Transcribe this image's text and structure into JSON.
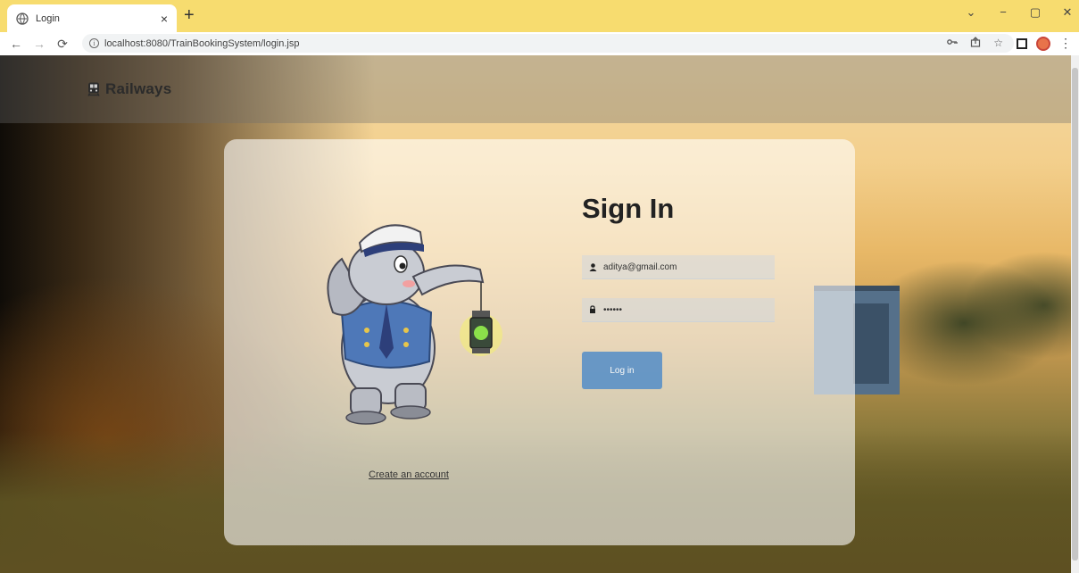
{
  "browser": {
    "tab_title": "Login",
    "tab_close": "×",
    "new_tab": "+",
    "url": "localhost:8080/TrainBookingSystem/login.jsp",
    "window_controls": [
      "⌄",
      "−",
      "▢",
      "✕"
    ],
    "icons": [
      "globe-icon",
      "key-icon",
      "share-icon",
      "star-icon",
      "extension-icon",
      "profile-avatar",
      "menu-icon"
    ]
  },
  "page": {
    "brand": "Railways",
    "title": "Sign In",
    "email_value": "aditya@gmail.com",
    "password_value": "••••••",
    "login_label": "Log in",
    "create_account": "Create an account",
    "colors": {
      "header_bar": "#f7dc6f",
      "button": "#5b91c7"
    }
  }
}
